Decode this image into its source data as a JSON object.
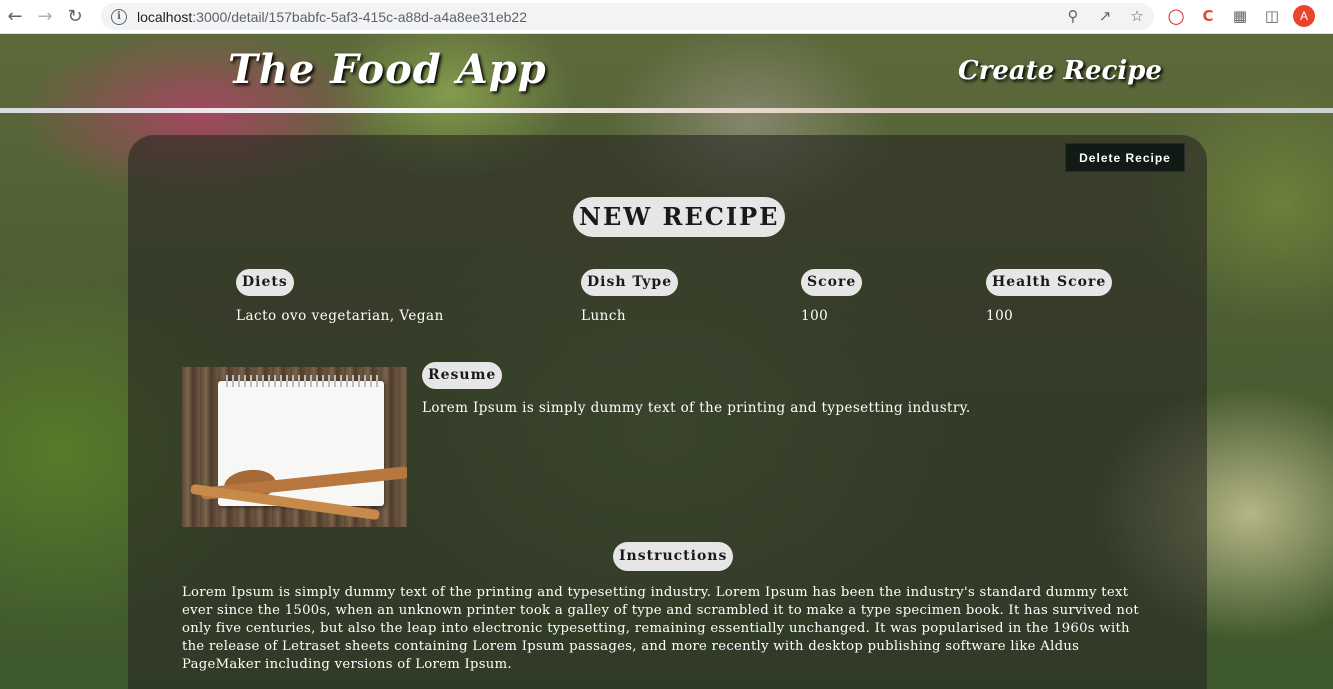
{
  "browser": {
    "url_host": "localhost",
    "url_path": ":3000/detail/157babfc-5af3-415c-a88d-a4a8ee31eb22",
    "avatar_letter": "A",
    "icons": [
      "back-arrow-icon",
      "forward-arrow-icon",
      "reload-icon",
      "info-icon",
      "zoom-icon",
      "share-icon",
      "star-icon",
      "opera-extension-icon",
      "c-extension-icon",
      "puzzle-icon",
      "sidebar-icon"
    ]
  },
  "header": {
    "brand": "The Food App",
    "create_link": "Create Recipe"
  },
  "recipe": {
    "delete_label": "Delete Recipe",
    "title": "NEW RECIPE",
    "fields": [
      {
        "label": "Diets",
        "value": "Lacto ovo vegetarian, Vegan"
      },
      {
        "label": "Dish Type",
        "value": "Lunch"
      },
      {
        "label": "Score",
        "value": "100"
      },
      {
        "label": "Health Score",
        "value": "100"
      }
    ],
    "resume_label": "Resume",
    "resume_text": "Lorem Ipsum is simply dummy text of the printing and typesetting industry.",
    "instructions_label": "Instructions",
    "instructions_text": "Lorem Ipsum is simply dummy text of the printing and typesetting industry. Lorem Ipsum has been the industry's standard dummy text ever since the 1500s, when an unknown printer took a galley of type and scrambled it to make a type specimen book. It has survived not only five centuries, but also the leap into electronic typesetting, remaining essentially unchanged. It was popularised in the 1960s with the release of Letraset sheets containing Lorem Ipsum passages, and more recently with desktop publishing software like Aldus PageMaker including versions of Lorem Ipsum."
  }
}
